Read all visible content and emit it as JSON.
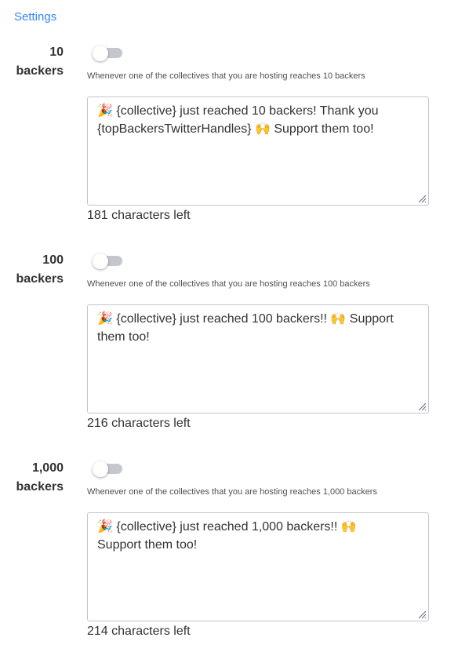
{
  "header": {
    "settings_link": "Settings"
  },
  "sections": [
    {
      "label_line1": "10",
      "label_line2": "backers",
      "enabled": false,
      "description": "Whenever one of the collectives that you are hosting reaches 10 backers",
      "message": "🎉 {collective} just reached 10 backers! Thank you {topBackersTwitterHandles} 🙌  Support them too!",
      "chars_left": "181 characters left"
    },
    {
      "label_line1": "100",
      "label_line2": "backers",
      "enabled": false,
      "description": "Whenever one of the collectives that you are hosting reaches 100 backers",
      "message": "🎉 {collective} just reached 100 backers!! 🙌  Support them too!",
      "chars_left": "216 characters left"
    },
    {
      "label_line1": "1,000",
      "label_line2": "backers",
      "enabled": false,
      "description": "Whenever one of the collectives that you are hosting reaches 1,000 backers",
      "message": "🎉 {collective} just reached 1,000 backers!! 🙌\nSupport them too!",
      "chars_left": "214 characters left"
    }
  ]
}
